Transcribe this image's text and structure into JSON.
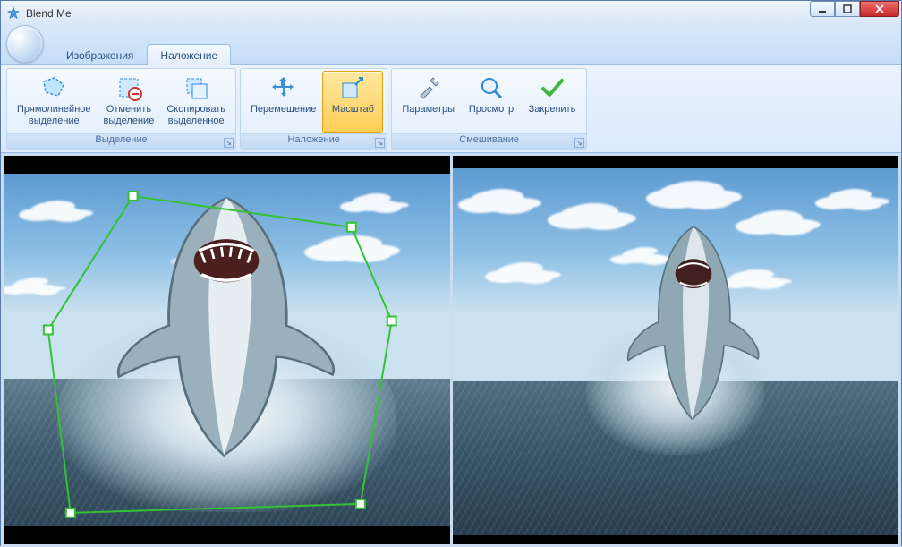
{
  "window": {
    "title": "Blend Me"
  },
  "tabs": {
    "images": "Изображения",
    "overlay": "Наложение",
    "active": "overlay"
  },
  "ribbon": {
    "groups": {
      "selection": {
        "title": "Выделение",
        "btn_rect": "Прямолинейное\nвыделение",
        "btn_cancel": "Отменить\nвыделение",
        "btn_copy": "Скопировать\nвыделенное"
      },
      "overlay": {
        "title": "Наложение",
        "btn_move": "Перемещение",
        "btn_scale": "Масштаб"
      },
      "blending": {
        "title": "Смешивание",
        "btn_params": "Параметры",
        "btn_preview": "Просмотр",
        "btn_apply": "Закрепить"
      }
    }
  },
  "colors": {
    "accent": "#ffce55",
    "ribbon_border": "#bed6ef",
    "selection_stroke": "#33c233"
  }
}
